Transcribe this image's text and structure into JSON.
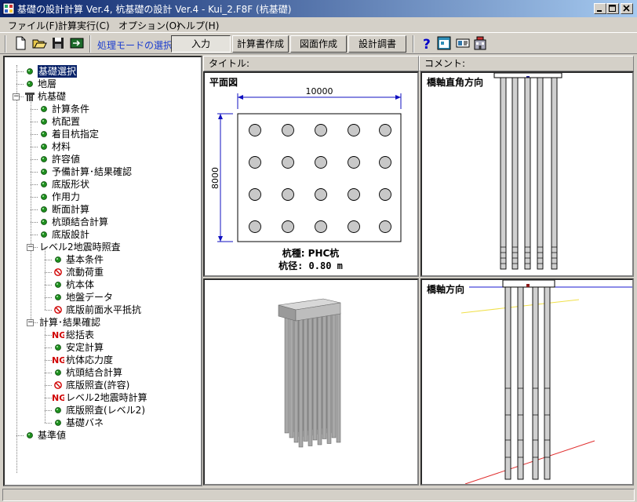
{
  "window": {
    "title": "基礎の設計計算 Ver.4, 杭基礎の設計 Ver.4 - Kui_2.F8F (杭基礎)",
    "buttons": [
      "0",
      "1",
      "r"
    ]
  },
  "menu": {
    "items": [
      "ファイル(F)",
      "計算実行(C)",
      "オプション(O)",
      "ヘルプ(H)"
    ]
  },
  "toolbar": {
    "mode_label": "処理モードの選択",
    "input_button": "入力",
    "calc_report_button": "計算書作成",
    "drawing_button": "図面作成",
    "design_report_button": "設計調書"
  },
  "tree": {
    "root_items": {
      "foundation_select": "基礎選択",
      "strata": "地層",
      "pile_foundation": "杭基礎",
      "standard_values": "基準値"
    },
    "pile_children": [
      "計算条件",
      "杭配置",
      "着目杭指定",
      "材料",
      "許容値",
      "予備計算･結果確認",
      "底版形状",
      "作用力",
      "断面計算",
      "杭頭結合計算",
      "底版設計"
    ],
    "level2": {
      "label": "レベル2地震時照査",
      "children": [
        "基本条件",
        "流動荷重",
        "杭本体",
        "地盤データ",
        "底版前面水平抵抗"
      ]
    },
    "results": {
      "label": "計算･結果確認",
      "children": [
        "総括表",
        "安定計算",
        "杭体応力度",
        "杭頭結合計算",
        "底版照査(許容)",
        "レベル2地震時計算",
        "底版照査(レベル2)",
        "基礎バネ"
      ]
    },
    "ng_badge": "NG"
  },
  "headers": {
    "title_label": "タイトル:",
    "comment_label": "コメント:"
  },
  "plan": {
    "title": "平面図",
    "width_dim": "10000",
    "height_dim": "8000",
    "pile_type": "杭種: PHC杭",
    "pile_diameter": "杭径: 0.80 m"
  },
  "side_views": {
    "perpendicular_title": "橋軸直角方向",
    "parallel_title": "橋軸方向"
  },
  "colors": {
    "title_gradient_start": "#0a246a",
    "title_gradient_end": "#a6caf0",
    "selection": "#0a246a",
    "mode_label": "#1a3ccf",
    "ng_badge": "#d00000",
    "status_ok": "#1f8f1f"
  }
}
